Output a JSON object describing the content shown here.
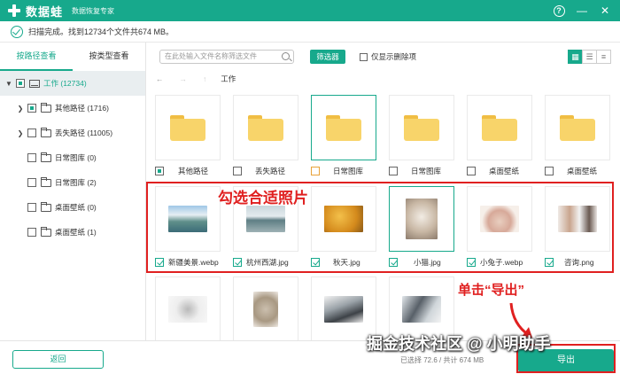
{
  "app": {
    "name": "数据蛙",
    "subtitle": "数据恢复专家"
  },
  "window_controls": {
    "help": "?",
    "minimize": "—",
    "close": "✕"
  },
  "status": {
    "text": "扫描完成。找到12734个文件共674 MB。"
  },
  "sidebar": {
    "tabs": [
      {
        "label": "按路径查看",
        "active": true
      },
      {
        "label": "按类型查看",
        "active": false
      }
    ],
    "tree": [
      {
        "label": "工作 (12734)",
        "level": 0,
        "caret": "▼",
        "selected": true
      },
      {
        "label": "其他路径 (1716)",
        "level": 1,
        "caret": "❯"
      },
      {
        "label": "丢失路径 (11005)",
        "level": 1,
        "caret": "❯"
      },
      {
        "label": "日常图库 (0)",
        "level": 1,
        "caret": ""
      },
      {
        "label": "日常图库 (2)",
        "level": 1,
        "caret": ""
      },
      {
        "label": "桌面壁纸 (0)",
        "level": 1,
        "caret": ""
      },
      {
        "label": "桌面壁纸 (1)",
        "level": 1,
        "caret": ""
      }
    ]
  },
  "toolbar": {
    "search_placeholder": "在此处输入文件名称筛选文件",
    "filter_label": "筛选器",
    "only_deleted_label": "仅显示删除项",
    "view_icons": [
      "grid-view-icon",
      "list-view-icon",
      "detail-view-icon"
    ]
  },
  "breadcrumb": {
    "back": "←",
    "forward": "→",
    "up": "↑",
    "path": "工作"
  },
  "folders": [
    {
      "name": "其他路径"
    },
    {
      "name": "丢失路径"
    },
    {
      "name": "日常图库"
    },
    {
      "name": "日常图库"
    },
    {
      "name": "桌面壁纸"
    },
    {
      "name": "桌面壁纸"
    }
  ],
  "photos": [
    {
      "name": "新疆美景.webp",
      "checked": true
    },
    {
      "name": "杭州西湖.jpg",
      "checked": true
    },
    {
      "name": "秋天.jpg",
      "checked": true
    },
    {
      "name": "小猫.jpg",
      "checked": true
    },
    {
      "name": "小兔子.webp",
      "checked": true
    },
    {
      "name": "咨询.png",
      "checked": true
    }
  ],
  "annotations": {
    "select_hint": "勾选合适照片",
    "export_hint": "单击“导出”"
  },
  "bottom": {
    "back_label": "返回",
    "totals": "已选择 72.6 / 共计 674 MB",
    "export_label": "导出"
  },
  "watermark": "掘金技术社区 @ 小明助手",
  "colors": {
    "brand": "#17a98c",
    "annotation": "#e02020",
    "folder": "#f8d46a"
  }
}
